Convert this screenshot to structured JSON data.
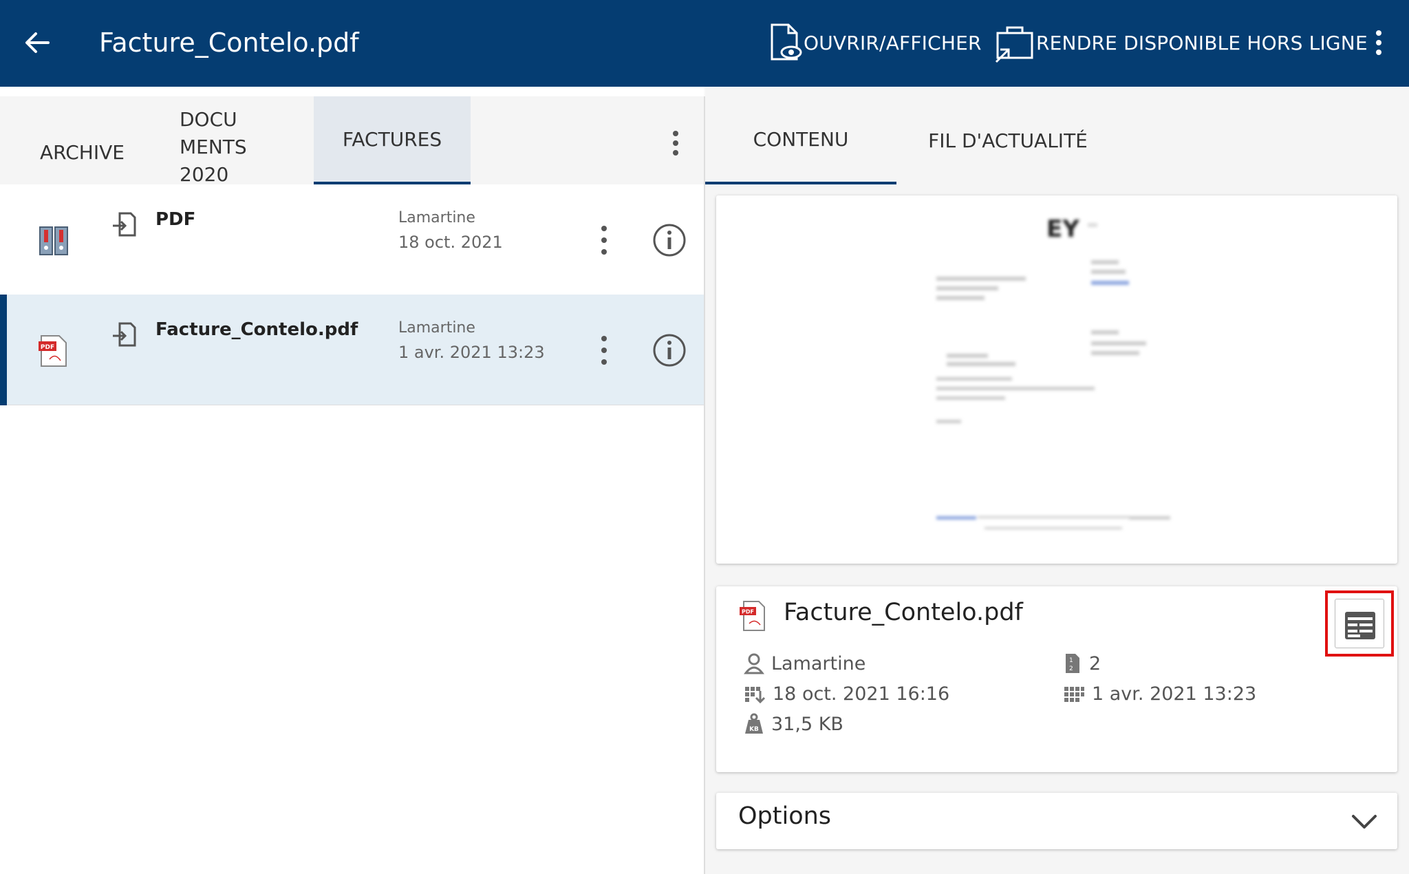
{
  "appbar": {
    "title": "Facture_Contelo.pdf",
    "open_label": "OUVRIR/AFFICHER",
    "offline_label": "RENDRE DISPONIBLE HORS LIGNE"
  },
  "left_tabs": {
    "archive": "ARCHIVE",
    "documents": "DOCU MENTS 2020",
    "factures": "FACTURES"
  },
  "rows": [
    {
      "name": "PDF",
      "owner": "Lamartine",
      "date": "18 oct. 2021",
      "type_icon": "binder-icon"
    },
    {
      "name": "Facture_Contelo.pdf",
      "owner": "Lamartine",
      "date": "1 avr. 2021 13:23",
      "type_icon": "pdf-file-icon"
    }
  ],
  "right_tabs": {
    "contenu": "CONTENU",
    "fil": "FIL D'ACTUALITÉ"
  },
  "details": {
    "title": "Facture_Contelo.pdf",
    "owner": "Lamartine",
    "pages": "2",
    "archived_date": "18 oct. 2021 16:16",
    "created_date": "1 avr. 2021 13:23",
    "size": "31,5 KB"
  },
  "options": {
    "label": "Options"
  },
  "colors": {
    "primary": "#053d72",
    "selected_row": "#e4eef5",
    "highlight_box": "#e01010"
  }
}
